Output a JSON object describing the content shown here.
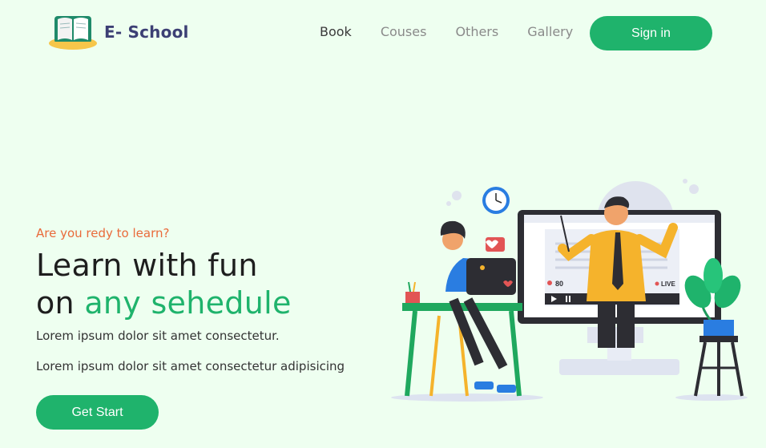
{
  "brand": {
    "name": "E- School"
  },
  "nav": {
    "items": [
      {
        "label": "Book"
      },
      {
        "label": "Couses"
      },
      {
        "label": "Others"
      },
      {
        "label": "Gallery"
      }
    ],
    "signin_label": "Sign in"
  },
  "hero": {
    "eyebrow": "Are you redy to learn?",
    "title_line1": "Learn with fun",
    "title_line2_prefix": "on ",
    "title_line2_highlight": "any sehedule",
    "para1": "Lorem ipsum dolor sit amet consectetur.",
    "para2": "Lorem ipsum dolor sit amet consectetur adipisicing",
    "cta_label": "Get Start"
  },
  "illustration": {
    "viewer_count": "80",
    "live_label": "LIVE"
  },
  "colors": {
    "background": "#eefff0",
    "accent": "#1fb36c",
    "brand_text": "#3c3f74",
    "eyebrow": "#e96a3a"
  }
}
